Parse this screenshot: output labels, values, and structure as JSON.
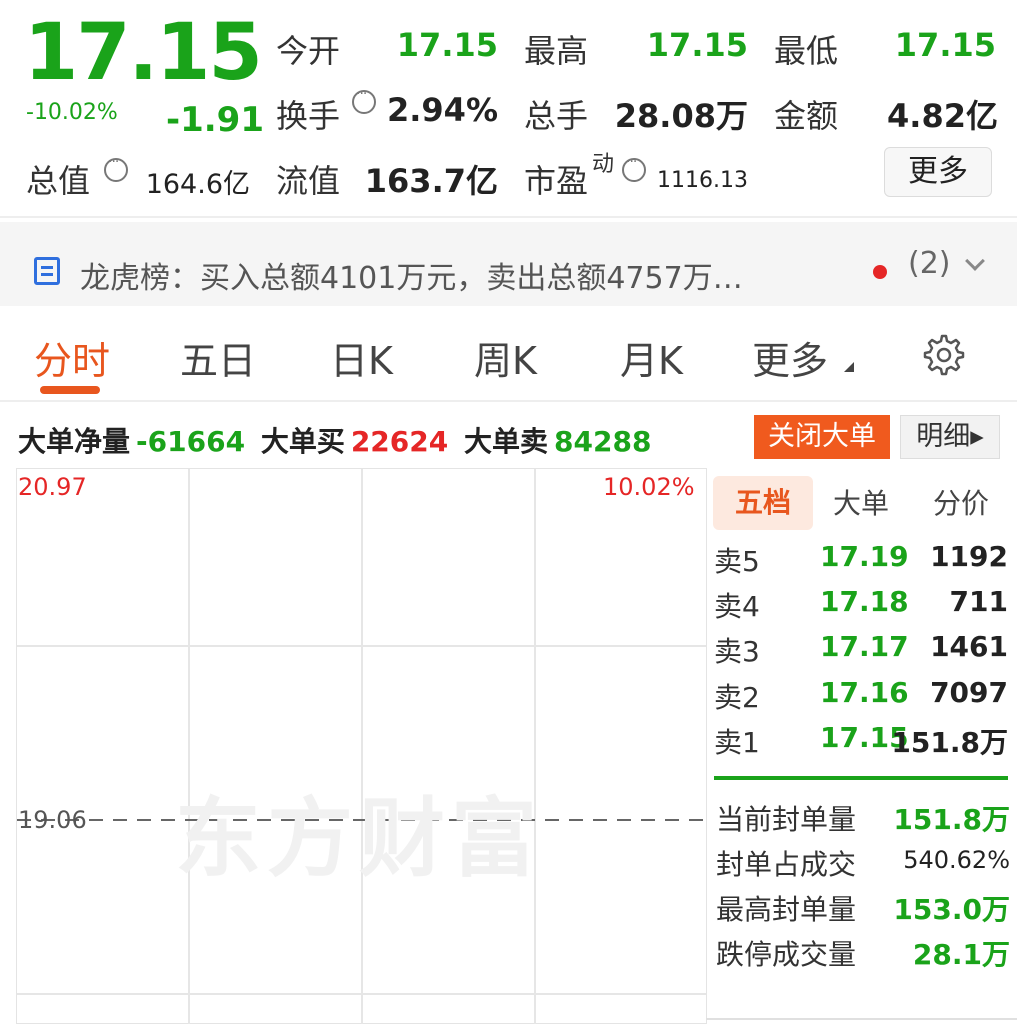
{
  "quote": {
    "price": "17.15",
    "change_pct": "-10.02%",
    "change": "-1.91",
    "open_label": "今开",
    "open": "17.15",
    "high_label": "最高",
    "high": "17.15",
    "low_label": "最低",
    "low": "17.15",
    "turnover_label": "换手",
    "turnover": "2.94%",
    "volume_label": "总手",
    "volume": "28.08万",
    "amount_label": "金额",
    "amount": "4.82亿",
    "mktcap_label": "总值",
    "mktcap": "164.6亿",
    "float_label": "流值",
    "float": "163.7亿",
    "pe_label": "市盈",
    "pe_sup": "动",
    "pe": "1116.13",
    "more_label": "更多"
  },
  "dragon": {
    "text": "龙虎榜：买入总额4101万元，卖出总额4757万…",
    "count": "(2)"
  },
  "tabs": [
    "分时",
    "五日",
    "日K",
    "周K",
    "月K",
    "更多"
  ],
  "bigorder": {
    "net_label": "大单净量",
    "net": "-61664",
    "buy_label": "大单买",
    "buy": "22624",
    "sell_label": "大单卖",
    "sell": "84288",
    "close_label": "关闭大单",
    "detail_label": "明细▸"
  },
  "chart": {
    "ymax": "20.97",
    "pct_max": "10.02%",
    "prev_close": "19.06",
    "watermark": "东方财富"
  },
  "book": {
    "tabs": [
      "五档",
      "大单",
      "分价"
    ],
    "asks": [
      {
        "label": "卖5",
        "price": "17.19",
        "vol": "1192"
      },
      {
        "label": "卖4",
        "price": "17.18",
        "vol": "711"
      },
      {
        "label": "卖3",
        "price": "17.17",
        "vol": "1461"
      },
      {
        "label": "卖2",
        "price": "17.16",
        "vol": "7097"
      },
      {
        "label": "卖1",
        "price": "17.15",
        "vol": "151.8万"
      }
    ],
    "stats": [
      {
        "label": "当前封单量",
        "value": "151.8万"
      },
      {
        "label": "封单占成交",
        "value": "540.62%"
      },
      {
        "label": "最高封单量",
        "value": "153.0万"
      },
      {
        "label": "跌停成交量",
        "value": "28.1万"
      }
    ]
  },
  "colors": {
    "down": "#1aa31a",
    "up": "#e52626",
    "accent": "#e8561e"
  }
}
